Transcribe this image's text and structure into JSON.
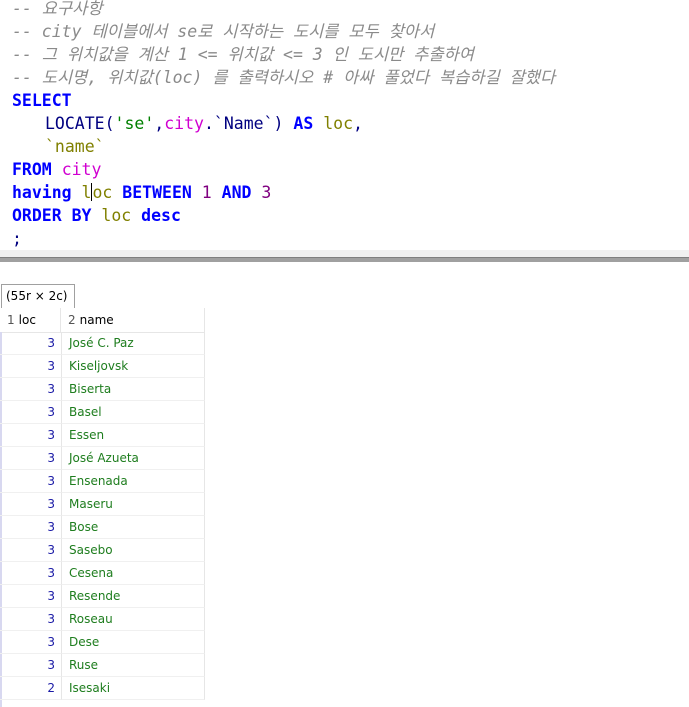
{
  "editor": {
    "comments": [
      "-- 요구사항",
      "-- city 테이블에서 se로 시작하는 도시를 모두 찾아서",
      "-- 그 위치값을 계산 1 <= 위치값 <= 3 인 도시만 추출하여",
      "-- 도시명, 위치값(loc) 를 출력하시오 # 아싸 풀었다 복습하길 잘했다"
    ],
    "kw_select": "SELECT",
    "fn_locate": "LOCATE",
    "paren_open": "(",
    "str_se": "'se'",
    "comma": ",",
    "tbl_city": "city",
    "col_name_qualified": ".`Name`",
    "paren_close": ")",
    "kw_as": "AS",
    "alias_loc": "loc",
    "comma2": ",",
    "col_name": "`name`",
    "kw_from": "FROM",
    "from_table": "city",
    "kw_having": "having",
    "having_col_a": "l",
    "having_col_b": "oc",
    "kw_between": "BETWEEN",
    "num_1": "1",
    "kw_and": "AND",
    "num_3": "3",
    "kw_order_by": "ORDER BY",
    "order_col": "loc",
    "kw_desc": "desc",
    "terminator": ";"
  },
  "result_tab": {
    "label": "(55r × 2c)"
  },
  "grid": {
    "columns": [
      {
        "index": "1",
        "label": "loc"
      },
      {
        "index": "2",
        "label": "name"
      }
    ],
    "rows": [
      {
        "loc": "3",
        "name": "José C. Paz"
      },
      {
        "loc": "3",
        "name": "Kiseljovsk"
      },
      {
        "loc": "3",
        "name": "Biserta"
      },
      {
        "loc": "3",
        "name": "Basel"
      },
      {
        "loc": "3",
        "name": "Essen"
      },
      {
        "loc": "3",
        "name": "José Azueta"
      },
      {
        "loc": "3",
        "name": "Ensenada"
      },
      {
        "loc": "3",
        "name": "Maseru"
      },
      {
        "loc": "3",
        "name": "Bose"
      },
      {
        "loc": "3",
        "name": "Sasebo"
      },
      {
        "loc": "3",
        "name": "Cesena"
      },
      {
        "loc": "3",
        "name": "Resende"
      },
      {
        "loc": "3",
        "name": "Roseau"
      },
      {
        "loc": "3",
        "name": "Dese"
      },
      {
        "loc": "3",
        "name": "Ruse"
      },
      {
        "loc": "2",
        "name": "Isesaki"
      }
    ]
  }
}
